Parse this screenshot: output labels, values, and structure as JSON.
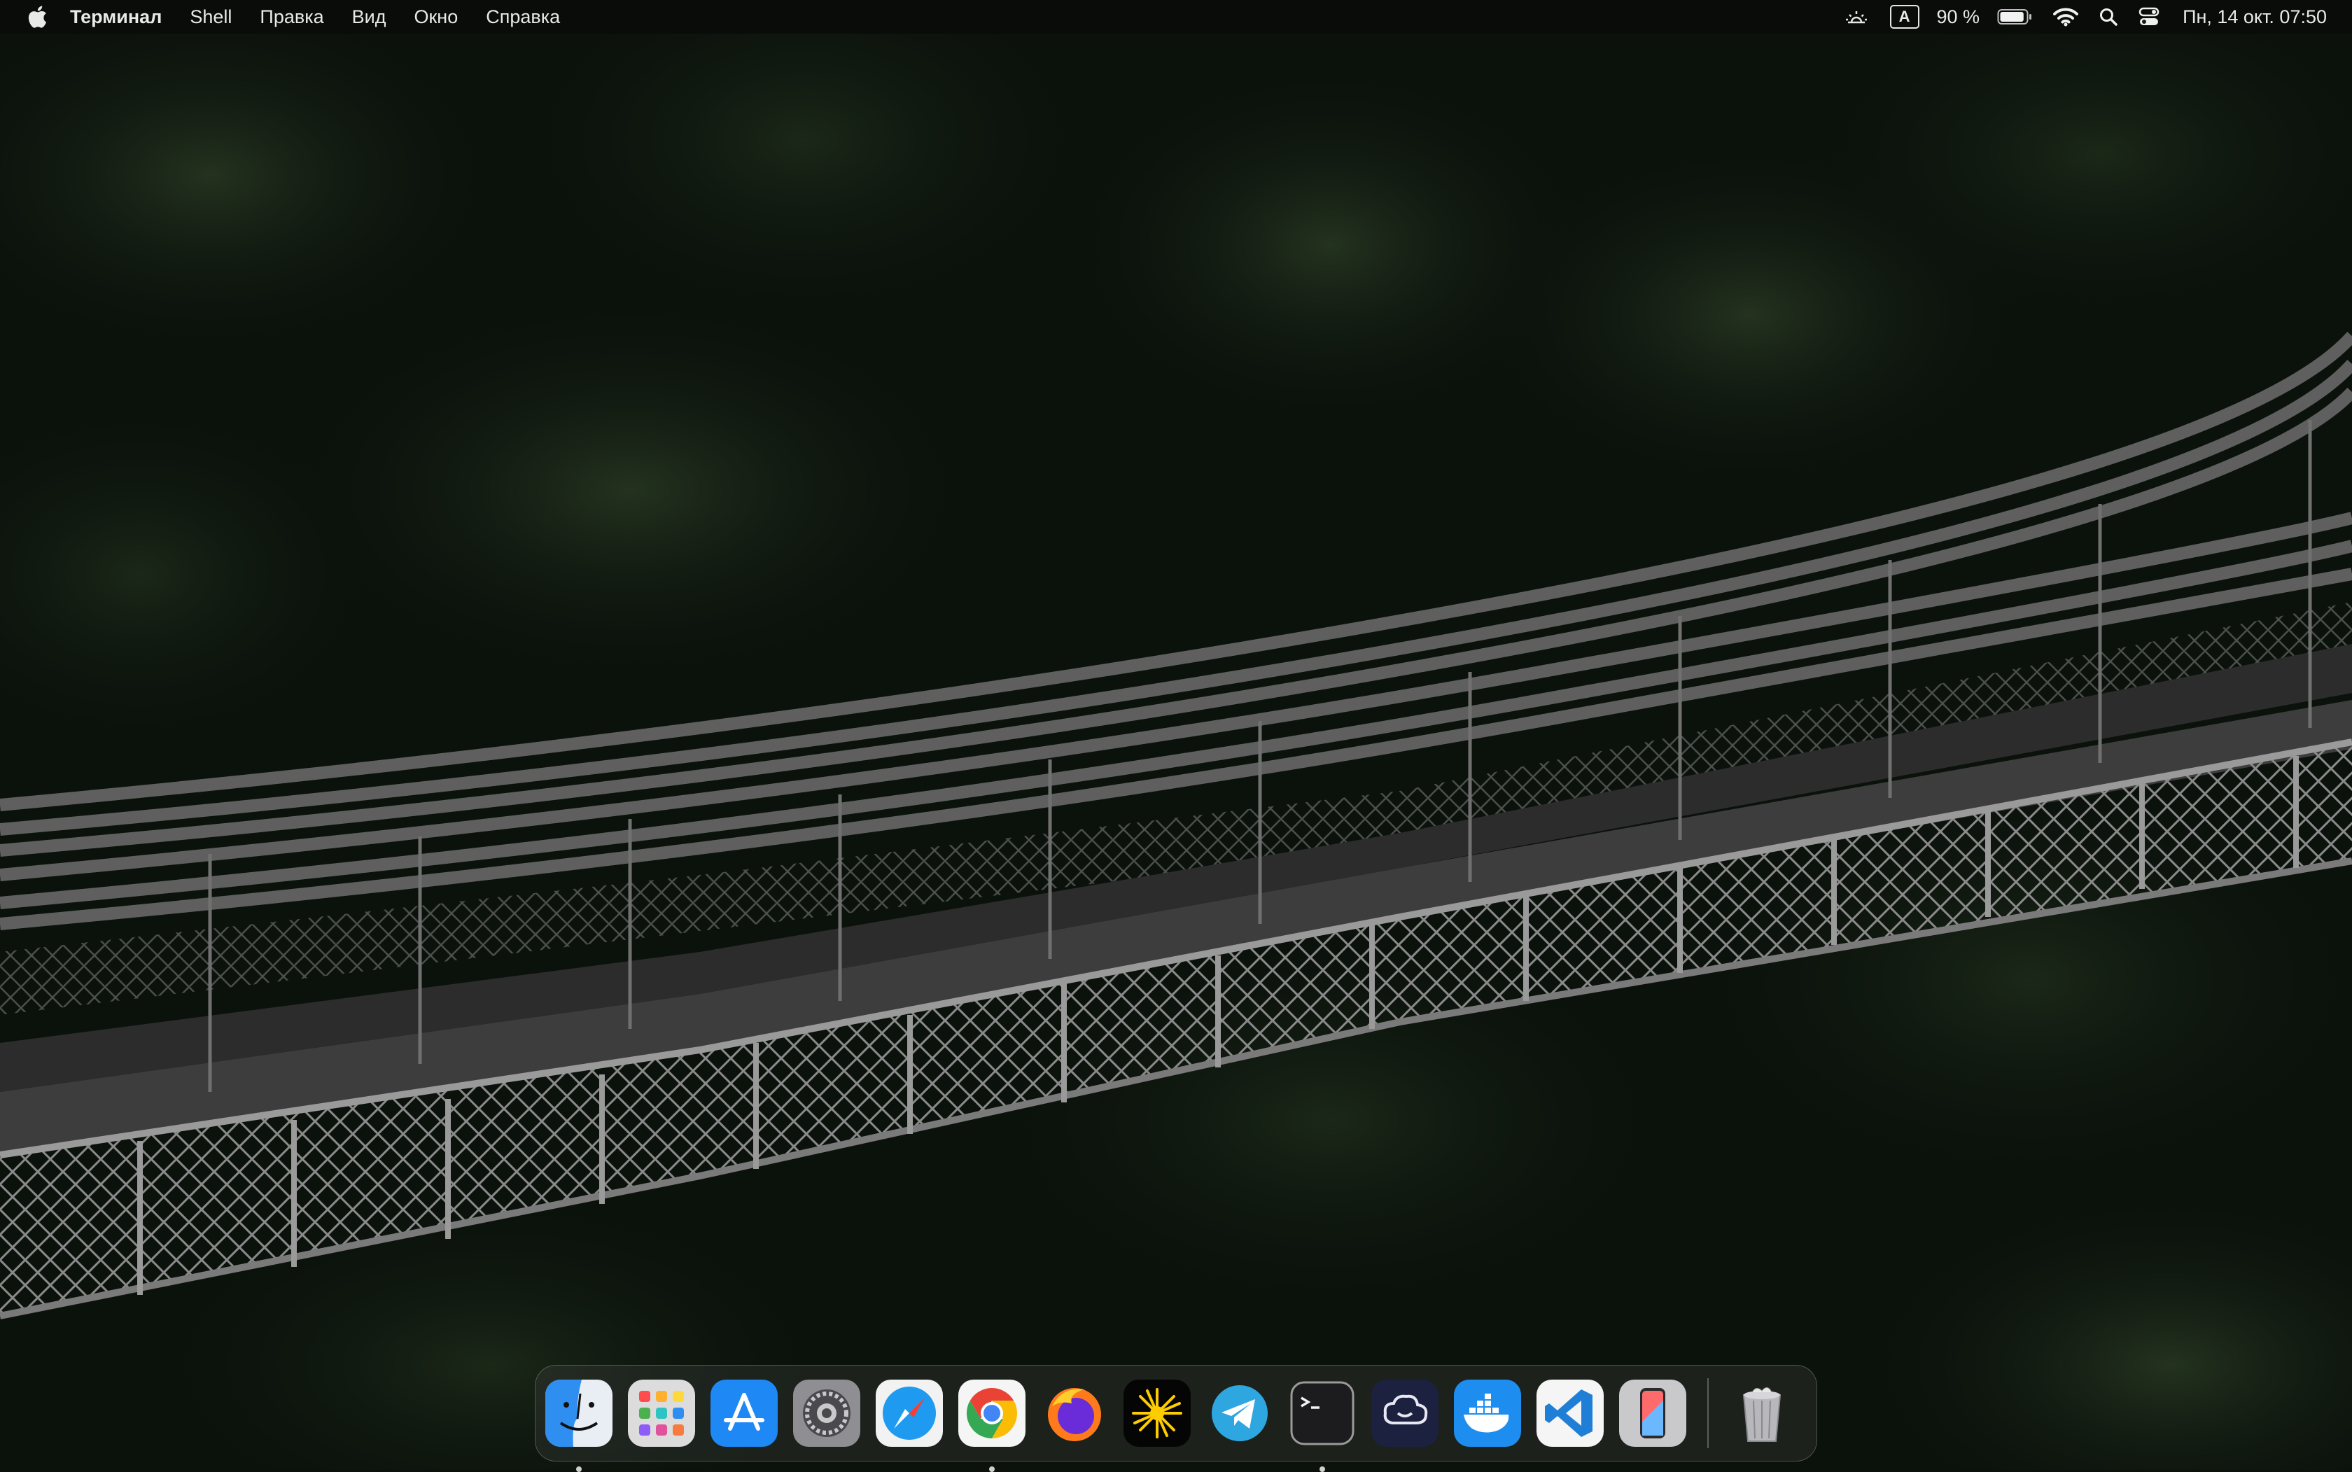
{
  "menubar": {
    "apple_icon": "apple-icon",
    "app_name": "Терминал",
    "items": [
      "Shell",
      "Правка",
      "Вид",
      "Окно",
      "Справка"
    ],
    "status": {
      "brightness_icon": "display-brightness-icon",
      "keyboard_layout": "A",
      "battery_percent": "90 %",
      "battery_level": 0.9,
      "wifi_icon": "wifi-icon",
      "search_icon": "spotlight-search-icon",
      "control_center_icon": "control-center-icon",
      "datetime": "Пн, 14 окт.  07:50"
    }
  },
  "dock": {
    "apps": [
      {
        "name": "Finder",
        "icon": "finder-icon",
        "running": true
      },
      {
        "name": "Launchpad",
        "icon": "launchpad-icon",
        "running": false
      },
      {
        "name": "App Store",
        "icon": "app-store-icon",
        "running": false
      },
      {
        "name": "System Settings",
        "icon": "system-settings-icon",
        "running": false
      },
      {
        "name": "Safari",
        "icon": "safari-icon",
        "running": false
      },
      {
        "name": "Google Chrome",
        "icon": "chrome-icon",
        "running": true
      },
      {
        "name": "Firefox",
        "icon": "firefox-icon",
        "running": false
      },
      {
        "name": "Spark",
        "icon": "spark-icon",
        "running": false
      },
      {
        "name": "Telegram",
        "icon": "telegram-icon",
        "running": false
      },
      {
        "name": "Terminal",
        "icon": "terminal-icon",
        "running": true
      },
      {
        "name": "ChatGPT",
        "icon": "chatgpt-icon",
        "running": false
      },
      {
        "name": "Docker",
        "icon": "docker-icon",
        "running": false
      },
      {
        "name": "Visual Studio Code",
        "icon": "vscode-icon",
        "running": false
      },
      {
        "name": "iPhone Mirroring",
        "icon": "iphone-mirroring-icon",
        "running": false
      }
    ],
    "trash": {
      "name": "Trash",
      "icon": "trash-icon"
    }
  },
  "colors": {
    "menubar_bg": "#0a0c0a",
    "foliage_dark": "#0b120c",
    "bridge_metal": "#5a5a5a"
  }
}
